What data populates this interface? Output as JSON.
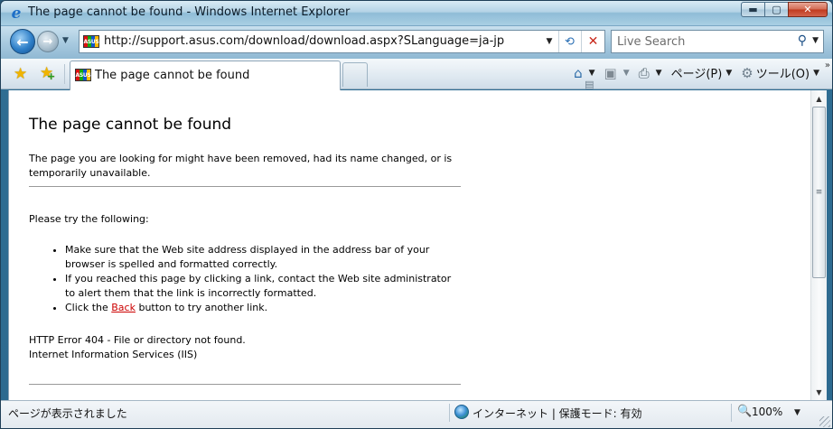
{
  "window": {
    "title": "The page cannot be found - Windows Internet Explorer",
    "minimize_glyph": "▬",
    "maximize_glyph": "▢",
    "close_glyph": "✕"
  },
  "navigation": {
    "back_glyph": "←",
    "forward_glyph": "→",
    "history_dropdown_glyph": "▼",
    "address": {
      "url": "http://support.asus.com/download/download.aspx?SLanguage=ja-jp",
      "favicon_text": "ASUS",
      "dropdown_glyph": "▼",
      "refresh_glyph": "⟲",
      "stop_glyph": "✕"
    },
    "search": {
      "placeholder": "Live Search",
      "button_glyph": "⚲",
      "dropdown_glyph": "▼"
    }
  },
  "commandbar": {
    "favorites_center_glyph": "★",
    "add_favorite_glyph": "★",
    "add_favorite_plus": "+",
    "tab": {
      "title": "The page cannot be found",
      "favicon_text": "ASUS"
    },
    "home_glyph": "⌂",
    "feeds_glyph": "▣",
    "print_glyph": "⎙",
    "page_glyph": "▤",
    "page_label": "ページ(P)",
    "tools_glyph": "⚙",
    "tools_label": "ツール(O)",
    "arrow_glyph": "▼",
    "more_glyph": "»"
  },
  "page": {
    "heading": "The page cannot be found",
    "intro": "The page you are looking for might have been removed, had its name changed, or is temporarily unavailable.",
    "try_heading": "Please try the following:",
    "suggestions": [
      "Make sure that the Web site address displayed in the address bar of your browser is spelled and formatted correctly.",
      "If you reached this page by clicking a link, contact the Web site administrator to alert them that the link is incorrectly formatted."
    ],
    "back_prefix": "Click the ",
    "back_link": "Back",
    "back_suffix": " button to try another link.",
    "error_line1": "HTTP Error 404 - File or directory not found.",
    "error_line2": "Internet Information Services (IIS)"
  },
  "scrollbar": {
    "up_glyph": "▲",
    "down_glyph": "▼",
    "grip_glyph": "≡",
    "position": 0.0,
    "visible_fraction": 0.62
  },
  "statusbar": {
    "status_text": "ページが表示されました",
    "zone_text": "インターネット | 保護モード: 有効",
    "zoom_glyph": "🔍",
    "zoom_text": "100%",
    "zoom_arrow": "▼"
  },
  "colors": {
    "link_red": "#cc0000",
    "ie_blue": "#1e6fc7",
    "close_red": "#c0391f"
  }
}
